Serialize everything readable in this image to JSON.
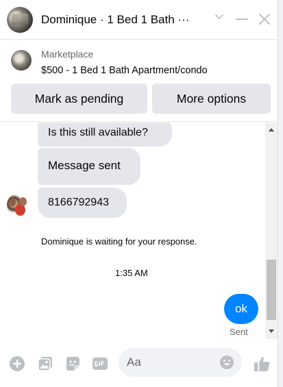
{
  "header": {
    "title": "Dominique · 1 Bed 1 Bath ···",
    "icons": {
      "avatar": "profile-photo",
      "chevron": "chevron-down-icon",
      "minimize": "minimize-icon",
      "close": "close-icon"
    }
  },
  "product": {
    "source_label": "Marketplace",
    "listing_title": "$500 - 1 Bed 1 Bath Apartment/condo",
    "mark_pending_label": "Mark as pending",
    "more_options_label": "More options"
  },
  "messages": [
    {
      "text": "Is this still available?"
    },
    {
      "text": "Message sent"
    },
    {
      "text": "8166792943"
    }
  ],
  "status": {
    "waiting": "Dominique is waiting for your response.",
    "timestamp": "1:35 AM",
    "outgoing": {
      "text": "ok",
      "status": "Sent"
    }
  },
  "composer": {
    "placeholder": "Aa",
    "icons": [
      "plus-icon",
      "photo-icon",
      "sticker-icon",
      "gif-icon",
      "emoji-icon",
      "like-icon"
    ]
  },
  "colors": {
    "accent": "#0084ff",
    "icon": "#bcc0c4",
    "bubble": "#e4e6eb",
    "secondary_text": "#65676b"
  }
}
